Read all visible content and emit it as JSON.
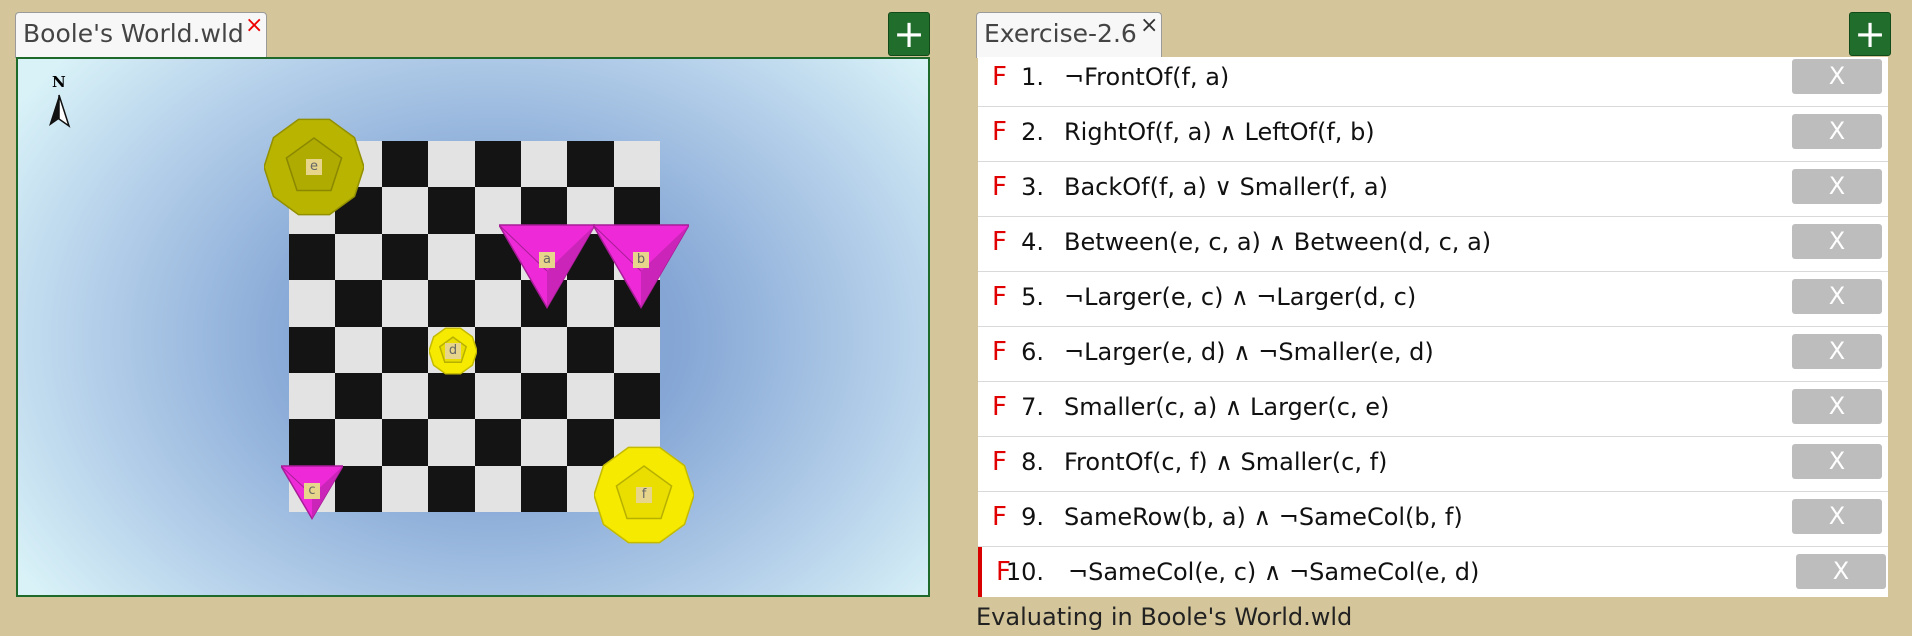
{
  "world_panel": {
    "tab_label": "Boole's World.wld",
    "tab_close": "×",
    "add_label": "+",
    "compass_label": "N",
    "board_colors": {
      "light": "#e3e3e3",
      "dark": "#141414"
    },
    "objects": [
      {
        "label": "e",
        "shape": "dodecahedron",
        "size": "large",
        "color": "#b8b400"
      },
      {
        "label": "a",
        "shape": "tetrahedron",
        "size": "large",
        "color": "#ee2ad8"
      },
      {
        "label": "b",
        "shape": "tetrahedron",
        "size": "large",
        "color": "#ee2ad8"
      },
      {
        "label": "d",
        "shape": "dodecahedron",
        "size": "small",
        "color": "#f5ea00"
      },
      {
        "label": "c",
        "shape": "tetrahedron",
        "size": "small",
        "color": "#ee2ad8"
      },
      {
        "label": "f",
        "shape": "dodecahedron",
        "size": "large",
        "color": "#f5ea00"
      }
    ]
  },
  "sentence_panel": {
    "tab_label": "Exercise-2.6",
    "tab_close": "×",
    "add_label": "+",
    "truth_color": "#e00000",
    "rows": [
      {
        "truth": "F",
        "num": "1.",
        "formula": "¬FrontOf(f, a)",
        "delete": "X"
      },
      {
        "truth": "F",
        "num": "2.",
        "formula": "RightOf(f, a) ∧ LeftOf(f, b)",
        "delete": "X"
      },
      {
        "truth": "F",
        "num": "3.",
        "formula": "BackOf(f, a) ∨ Smaller(f, a)",
        "delete": "X"
      },
      {
        "truth": "F",
        "num": "4.",
        "formula": "Between(e, c, a) ∧ Between(d, c, a)",
        "delete": "X"
      },
      {
        "truth": "F",
        "num": "5.",
        "formula": "¬Larger(e, c) ∧ ¬Larger(d, c)",
        "delete": "X"
      },
      {
        "truth": "F",
        "num": "6.",
        "formula": "¬Larger(e, d) ∧ ¬Smaller(e, d)",
        "delete": "X"
      },
      {
        "truth": "F",
        "num": "7.",
        "formula": "Smaller(c, a) ∧ Larger(c, e)",
        "delete": "X"
      },
      {
        "truth": "F",
        "num": "8.",
        "formula": "FrontOf(c, f) ∧ Smaller(c, f)",
        "delete": "X"
      },
      {
        "truth": "F",
        "num": "9.",
        "formula": "SameRow(b, a) ∧ ¬SameCol(b, f)",
        "delete": "X"
      },
      {
        "truth": "F",
        "num": "10.",
        "formula": "¬SameCol(e, c) ∧ ¬SameCol(e, d)",
        "delete": "X"
      }
    ]
  },
  "status": "Evaluating in Boole's World.wld"
}
